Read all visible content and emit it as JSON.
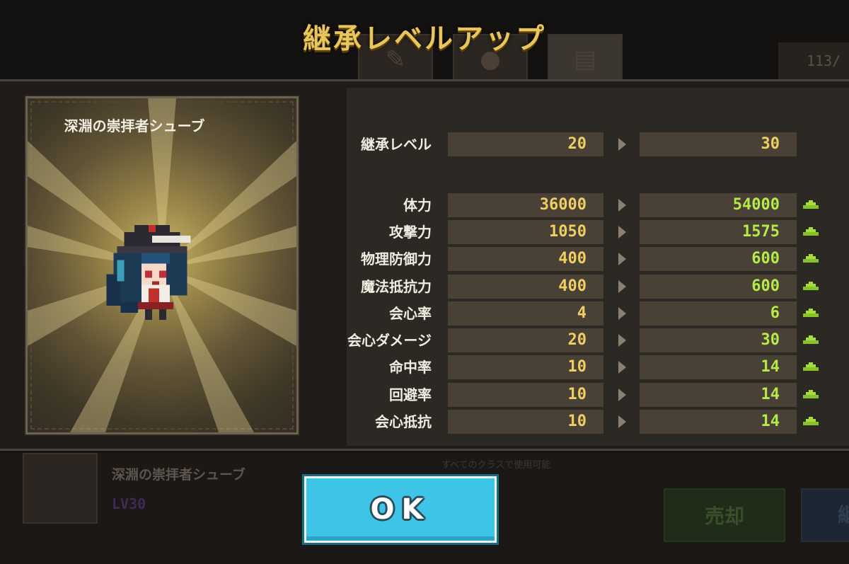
{
  "dialog": {
    "title": "継承レベルアップ",
    "character_name": "深淵の崇拝者シューブ",
    "ok_label": "OK"
  },
  "stats": [
    {
      "label": "継承レベル",
      "before": "20",
      "after": "30",
      "increase": false
    },
    {
      "label": "体力",
      "before": "36000",
      "after": "54000",
      "increase": true
    },
    {
      "label": "攻撃力",
      "before": "1050",
      "after": "1575",
      "increase": true
    },
    {
      "label": "物理防御力",
      "before": "400",
      "after": "600",
      "increase": true
    },
    {
      "label": "魔法抵抗力",
      "before": "400",
      "after": "600",
      "increase": true
    },
    {
      "label": "会心率",
      "before": "4",
      "after": "6",
      "increase": true
    },
    {
      "label": "会心ダメージ",
      "before": "20",
      "after": "30",
      "increase": true
    },
    {
      "label": "命中率",
      "before": "10",
      "after": "14",
      "increase": true
    },
    {
      "label": "回避率",
      "before": "10",
      "after": "14",
      "increase": true
    },
    {
      "label": "会心抵抗",
      "before": "10",
      "after": "14",
      "increase": true
    }
  ],
  "background": {
    "item_count": "113/",
    "character_name": "深淵の崇拝者シューブ",
    "level": "LV30",
    "sell_label": "売却",
    "other_label": "継",
    "class_hint": "すべてのクラスで使用可能"
  },
  "colors": {
    "title": "#e8c65c",
    "old_value": "#f0cf62",
    "new_value": "#b6ea4a",
    "ok_button": "#3ec4e6"
  },
  "icons": [
    "weapon-icon",
    "accessory-icon",
    "book-icon",
    "increase-arrow-icon",
    "right-arrow-icon"
  ]
}
